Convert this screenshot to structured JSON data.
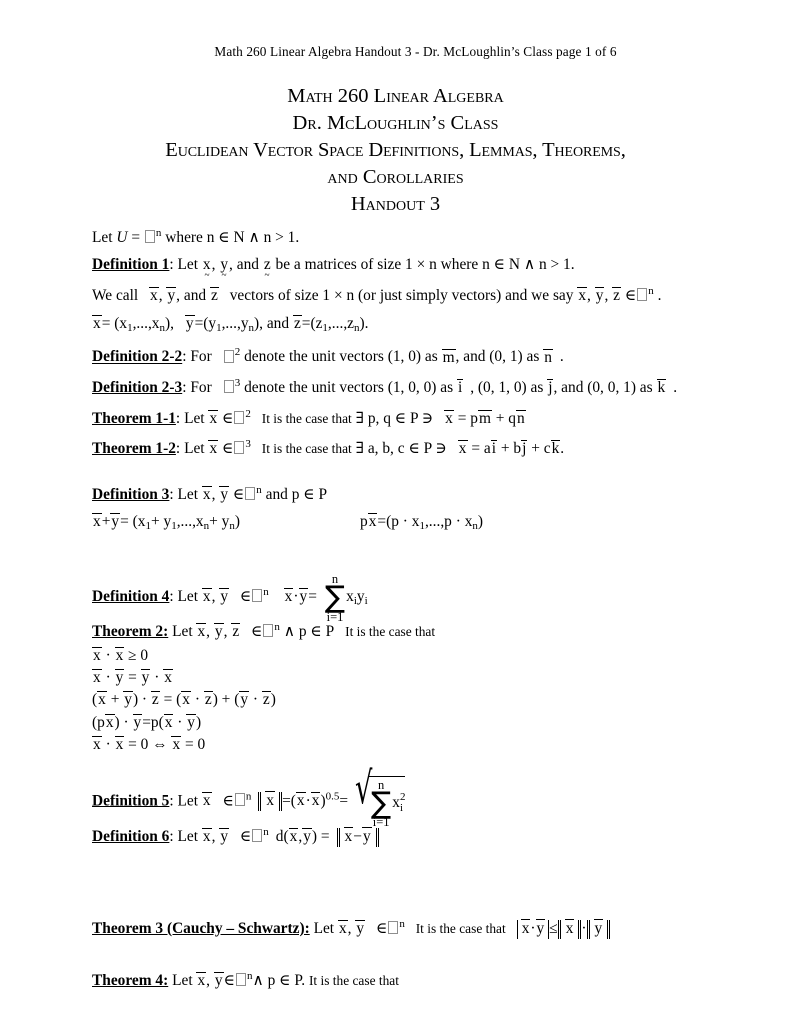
{
  "document": {
    "running_header": "Math 260 Linear Algebra Handout 3 - Dr. McLoughlin’s Class page 1 of 6",
    "title_lines": [
      "Math 260  Linear Algebra",
      "Dr. McLoughlin’s Class",
      "Euclidean Vector Space Definitions, Lemmas, Theorems,",
      "and Corollaries",
      "Handout 3"
    ],
    "page_number": "1",
    "page_total": "6",
    "background_color": "#ffffff",
    "text_color": "#000000"
  },
  "preamble": {
    "let_u": "Let",
    "u_symbol": "U",
    "equals": "=",
    "exponent_n": "n",
    "where": "where n ∈ N ∧ n > 1."
  },
  "definition_1": {
    "label": "Definition 1",
    "colon": ":",
    "text_a": "Let",
    "var_x": "x",
    "var_y": "y",
    "var_z": "z",
    "text_b": "be a matrices of size 1 × n where n ∈ N ∧ n > 1.",
    "comma": ",",
    "and": "and"
  },
  "we_call": {
    "lead": "We call",
    "mid": "vectors of size 1 × n (or just simply vectors) and we say",
    "member": "∈",
    "exponent": "n",
    "period": "."
  },
  "components": {
    "x_eq": "= (x",
    "x_sub1": "1",
    "x_mid": ",...,x",
    "x_subn": "n",
    "close": ")",
    "y_eq": "=(y",
    "y_sub1": "1",
    "y_mid": ",...,y",
    "y_subn": "n",
    "z_eq": "=(z",
    "z_sub1": "1",
    "z_mid": ",...,z",
    "z_subn": "n",
    "and": ", and",
    "period": "."
  },
  "definition_2_2": {
    "label": "Definition 2-2",
    "colon": ":",
    "text_a": "For",
    "exponent": "2",
    "text_b": "denote the unit vectors (1, 0) as",
    "vec_m": "m",
    "text_c": ", and (0, 1) as",
    "vec_n": "n",
    "period": "."
  },
  "definition_2_3": {
    "label": "Definition 2-3",
    "colon": ":",
    "text_a": "For",
    "exponent": "3",
    "text_b": "denote the unit vectors (1, 0, 0) as",
    "vec_i": "i",
    "text_c": ", (0, 1, 0) as",
    "vec_j": "j",
    "text_d": ", and (0, 0, 1) as",
    "vec_k": "k",
    "period": "."
  },
  "theorem_1_1": {
    "label": "Theorem 1-1",
    "colon": ":",
    "text_a": "Let",
    "vec_x": "x",
    "member": "∈",
    "exponent": "2",
    "text_b": "It is the case that",
    "exists": "∃",
    "vars": "p, q",
    "in_p": "∈ P",
    "suchthat": "∋",
    "eq_lhs": "x",
    "eq_mid": "= p",
    "vec_m": "m",
    "plus": "+ q",
    "vec_n": "n"
  },
  "theorem_1_2": {
    "label": "Theorem 1-2",
    "colon": ":",
    "text_a": "Let",
    "vec_x": "x",
    "member": "∈",
    "exponent": "3",
    "text_b": "It is the case that",
    "exists": "∃",
    "vars": "a, b, c",
    "in_p": "∈ P",
    "suchthat": "∋",
    "eq_lhs": "x",
    "eq_mid": "= a",
    "vec_i": "i",
    "plus_b": "+ b",
    "vec_j": "j",
    "plus_c": "+ c",
    "vec_k": "k",
    "period": "."
  },
  "definition_3": {
    "label": "Definition 3",
    "colon": ":",
    "text_a": "Let",
    "vec_x": "x",
    "vec_y": "y",
    "member": "∈",
    "exponent": "n",
    "text_b": "and p ∈ P",
    "formula_left": {
      "x": "x",
      "plus": "+",
      "y": "y",
      "eq": "= (x",
      "sub1": "1",
      "plus_y1": "+ y",
      "mid": ",...,x",
      "subn": "n",
      "plus_yn": "+ y",
      "close": ")"
    },
    "formula_right": {
      "p": "p",
      "x": "x",
      "eq": "=(p · x",
      "sub1": "1",
      "mid": ",...,p · x",
      "subn": "n",
      "close": ")"
    }
  },
  "definition_4": {
    "label": "Definition 4",
    "colon": ":",
    "text_a": "Let",
    "vec_x": "x",
    "vec_y": "y",
    "member": "∈",
    "exponent": "n",
    "dot_lhs_x": "x",
    "dot": "·",
    "dot_lhs_y": "y",
    "eq": "=",
    "sum_upper": "n",
    "sum_glyph": "∑",
    "sum_lower": "i=1",
    "summand": "x",
    "summand_sub1": "i",
    "summand_y": "y",
    "summand_sub2": "i"
  },
  "theorem_2": {
    "label": "Theorem 2:",
    "text_a": "Let",
    "vec_x": "x",
    "vec_y": "y",
    "vec_z": "z",
    "member": "∈",
    "exponent": "n",
    "and_p": "∧ p ∈ P",
    "text_b": "It is the case that",
    "properties": [
      {
        "id": "nonneg",
        "parts": [
          "x",
          "·",
          "x",
          "≥ 0"
        ]
      },
      {
        "id": "commutative",
        "parts": [
          "x",
          "·",
          "y",
          "=",
          "y",
          "·",
          "x"
        ]
      },
      {
        "id": "distributive",
        "parts": [
          "(",
          "x",
          "+",
          "y",
          ") ·",
          "z",
          "= (",
          "x",
          "·",
          "z",
          ") + (",
          "y",
          "·",
          "z",
          ")"
        ]
      },
      {
        "id": "scalar",
        "parts": [
          "(p",
          "x",
          ") ·",
          "y",
          "=p(",
          "x",
          "·",
          "y",
          ")"
        ]
      },
      {
        "id": "zero",
        "parts": [
          "x",
          "·",
          "x",
          "= 0 ⇔",
          "x",
          "= 0"
        ]
      }
    ]
  },
  "definition_5": {
    "label": "Definition 5",
    "colon": ":",
    "text_a": "Let",
    "vec_x": "x",
    "member": "∈",
    "exponent": "n",
    "norm_x": "x",
    "eq1": "=(",
    "dot_x1": "x",
    "dot": "·",
    "dot_x2": "x",
    "close_pow": ")",
    "power": "0.5",
    "eq2": "=",
    "sum_upper": "n",
    "sum_glyph": "∑",
    "sum_lower": "i=1",
    "summand": "x",
    "summand_sub": "i",
    "summand_sup": "2"
  },
  "definition_6": {
    "label": "Definition 6",
    "colon": ":",
    "text_a": "Let",
    "vec_x": "x",
    "vec_y": "y",
    "member": "∈",
    "exponent": "n",
    "dist": "d(",
    "arg_x": "x",
    "comma": ",",
    "arg_y": "y",
    "close": ") =",
    "norm_x": "x",
    "minus": "−",
    "norm_y": "y"
  },
  "theorem_3": {
    "label": "Theorem 3 (Cauchy – Schwartz):",
    "text_a": "Let",
    "vec_x": "x",
    "vec_y": "y",
    "member": "∈",
    "exponent": "n",
    "text_b": "It is the case that",
    "abs_x": "x",
    "dot": "·",
    "abs_y": "y",
    "leq": "≤",
    "norm_x": "x",
    "norm_dot": "·",
    "norm_y": "y"
  },
  "theorem_4": {
    "label": "Theorem 4:",
    "text_a": "Let",
    "vec_x": "x",
    "comma": ",",
    "vec_y": "y",
    "member": "∈",
    "exponent": "n",
    "and_p": "∧ p ∈ P",
    "period": ".",
    "text_b": "It is the case that"
  }
}
